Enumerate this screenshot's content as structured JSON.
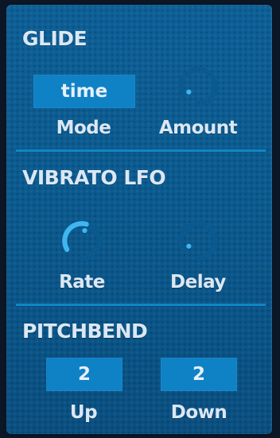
{
  "glide": {
    "title": "GLIDE",
    "mode": {
      "value": "time",
      "label": "Mode"
    },
    "amount": {
      "label": "Amount",
      "level": 0.0
    }
  },
  "vibrato": {
    "title": "VIBRATO LFO",
    "rate": {
      "label": "Rate",
      "level": 0.45
    },
    "delay": {
      "label": "Delay",
      "level": 0.0
    }
  },
  "pitchbend": {
    "title": "PITCHBEND",
    "up": {
      "value": "2",
      "label": "Up"
    },
    "down": {
      "value": "2",
      "label": "Down"
    }
  },
  "colors": {
    "accent": "#3fb6f0",
    "track": "#0a5a90",
    "panel": "#0b5a8f",
    "selector_bg": "#0f81c5",
    "text": "#dbe7f3"
  }
}
